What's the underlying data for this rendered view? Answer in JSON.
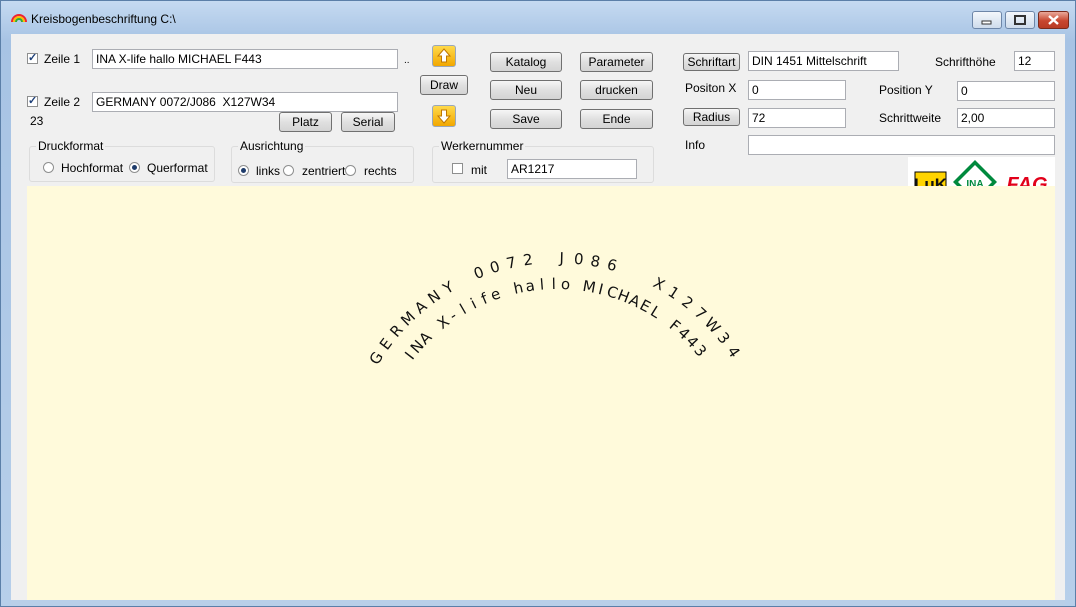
{
  "window": {
    "title": "Kreisbogenbeschriftung C:\\"
  },
  "line1": {
    "label": "Zeile 1",
    "checked": true,
    "value": "INA X-life hallo MICHAEL F443",
    "more": ".."
  },
  "line2": {
    "label": "Zeile 2",
    "checked": true,
    "value": "GERMANY 0072/J086  X127W34",
    "counter": "23"
  },
  "buttons": {
    "draw": "Draw",
    "platz": "Platz",
    "serial": "Serial",
    "katalog": "Katalog",
    "parameter": "Parameter",
    "neu": "Neu",
    "drucken": "drucken",
    "save": "Save",
    "ende": "Ende",
    "schriftart": "Schriftart",
    "radius": "Radius"
  },
  "druckformat": {
    "title": "Druckformat",
    "options": [
      "Hochformat",
      "Querformat"
    ],
    "selected": "Querformat"
  },
  "ausrichtung": {
    "title": "Ausrichtung",
    "options": [
      "links",
      "zentriert",
      "rechts"
    ],
    "selected": "links"
  },
  "werkernummer": {
    "title": "Werkernummer",
    "checkbox_label": "mit",
    "checked": false,
    "value": "AR1217"
  },
  "font": {
    "value": "DIN 1451 Mittelschrift"
  },
  "schrifthoehe": {
    "label": "Schrifthöhe",
    "value": "12"
  },
  "position_x": {
    "label": "Positon X",
    "value": "0"
  },
  "position_y": {
    "label": "Position Y",
    "value": "0"
  },
  "radius": {
    "value": "72"
  },
  "schrittweite": {
    "label": "Schrittweite",
    "value": "2,00"
  },
  "info": {
    "label": "Info",
    "value": ""
  },
  "logos": {
    "luk": "LuK",
    "ina": "INA",
    "fag": "FAG"
  },
  "preview": {
    "line1": "INA X-life hallo MICHAEL F443",
    "line2": "GERMANY 0072 J086  X127W34"
  },
  "colors": {
    "canvas": "#fffadb",
    "arrow": "#f2a700",
    "luk": "#ffd400",
    "ina": "#00893d",
    "fag": "#e2001a"
  }
}
